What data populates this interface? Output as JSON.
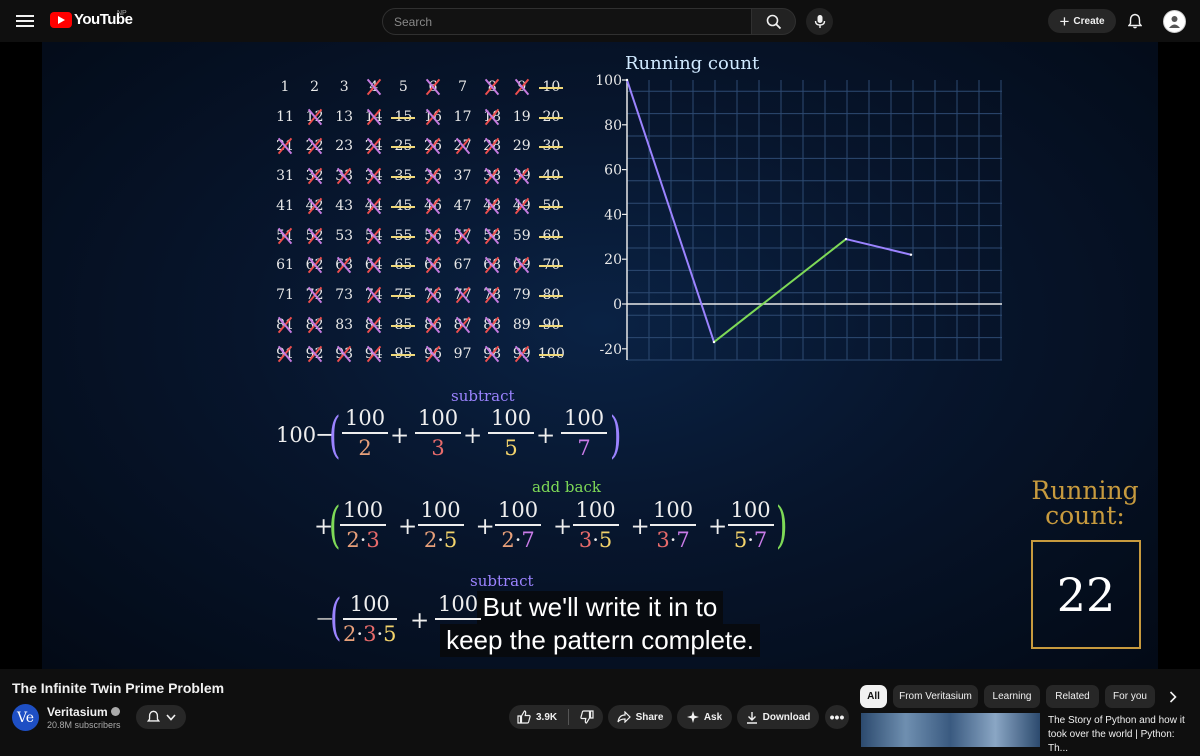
{
  "header": {
    "logo_text": "YouTube",
    "country_code": "NP",
    "search_placeholder": "Search",
    "create_label": "Create"
  },
  "video_frame": {
    "number_grid": {
      "rows": [
        [
          "1",
          "2",
          "3",
          "4",
          "5",
          "6",
          "7",
          "8",
          "9",
          "10"
        ],
        [
          "11",
          "12",
          "13",
          "14",
          "15",
          "16",
          "17",
          "18",
          "19",
          "20"
        ],
        [
          "21",
          "22",
          "23",
          "24",
          "25",
          "26",
          "27",
          "28",
          "29",
          "30"
        ],
        [
          "31",
          "32",
          "33",
          "34",
          "35",
          "36",
          "37",
          "38",
          "39",
          "40"
        ],
        [
          "41",
          "42",
          "43",
          "44",
          "45",
          "46",
          "47",
          "48",
          "49",
          "50"
        ],
        [
          "51",
          "52",
          "53",
          "54",
          "55",
          "56",
          "57",
          "58",
          "59",
          "60"
        ],
        [
          "61",
          "62",
          "63",
          "64",
          "65",
          "66",
          "67",
          "68",
          "69",
          "70"
        ],
        [
          "71",
          "72",
          "73",
          "74",
          "75",
          "76",
          "77",
          "78",
          "79",
          "80"
        ],
        [
          "81",
          "82",
          "83",
          "84",
          "85",
          "86",
          "87",
          "88",
          "89",
          "90"
        ],
        [
          "91",
          "92",
          "93",
          "94",
          "95",
          "96",
          "97",
          "98",
          "99",
          "100"
        ]
      ]
    },
    "chart": {
      "title": "Running count",
      "y_ticks": [
        "100",
        "80",
        "60",
        "40",
        "20",
        "0",
        "-20"
      ]
    },
    "subtract_label": "subtract",
    "add_back_label": "add back",
    "equation_lead": "100",
    "row1_fracs": [
      {
        "num": "100",
        "den": "2",
        "color": "#e8a07a"
      },
      {
        "num": "100",
        "den": "3",
        "color": "#e86b6b"
      },
      {
        "num": "100",
        "den": "5",
        "color": "#f3d36b"
      },
      {
        "num": "100",
        "den": "7",
        "color": "#c97be8"
      }
    ],
    "row2_fracs": [
      {
        "num": "100",
        "den": "2·3"
      },
      {
        "num": "100",
        "den": "2·5"
      },
      {
        "num": "100",
        "den": "2·7"
      },
      {
        "num": "100",
        "den": "3·5"
      },
      {
        "num": "100",
        "den": "3·7"
      },
      {
        "num": "100",
        "den": "5·7"
      }
    ],
    "row3_fracs": [
      {
        "num": "100",
        "den": "2·3·5"
      },
      {
        "num": "100",
        "den": ""
      }
    ],
    "running_count_label": "Running count:",
    "running_count_value": "22",
    "watermark": "Ve",
    "captions": [
      "But we'll write it in to",
      "keep the pattern complete."
    ]
  },
  "chart_data": {
    "type": "line",
    "title": "Running count",
    "xlabel": "",
    "ylabel": "",
    "ylim": [
      -25,
      100
    ],
    "x": [
      0,
      1,
      2,
      3
    ],
    "series": [
      {
        "values": [
          100,
          -17,
          29,
          22
        ],
        "colors": [
          "#9b83ff",
          "#7ed957",
          "#9b83ff"
        ]
      }
    ],
    "grid": true
  },
  "video_info": {
    "title": "The Infinite Twin Prime Problem",
    "channel_name": "Veritasium",
    "channel_avatar_text": "Ve",
    "subscribers": "20.8M subscribers",
    "like_count": "3.9K",
    "share_label": "Share",
    "ask_label": "Ask",
    "download_label": "Download"
  },
  "chips": [
    {
      "label": "All",
      "active": true
    },
    {
      "label": "From Veritasium",
      "active": false
    },
    {
      "label": "Learning",
      "active": false
    },
    {
      "label": "Related",
      "active": false
    },
    {
      "label": "For you",
      "active": false
    }
  ],
  "recommendation": {
    "title": "The Story of Python and how it took over the world | Python: Th..."
  },
  "colors": {
    "subtract": "#9b83ff",
    "add_back": "#7ed957",
    "running_count_gold": "#c79a3e",
    "youtube_red": "#ff0000"
  }
}
